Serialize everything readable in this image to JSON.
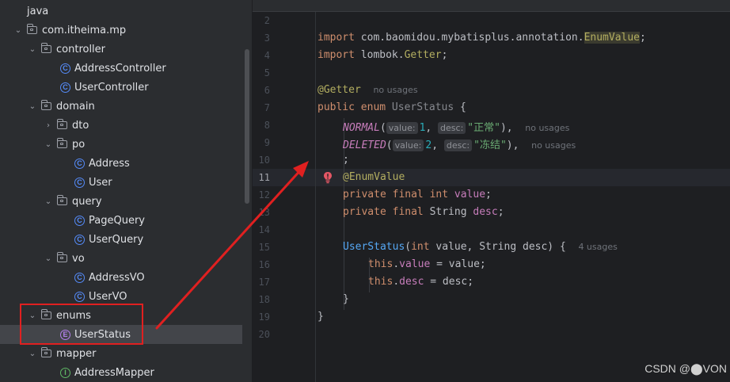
{
  "tree": {
    "items": [
      {
        "label": "java"
      },
      {
        "label": "com.itheima.mp"
      },
      {
        "label": "controller"
      },
      {
        "label": "AddressController"
      },
      {
        "label": "UserController"
      },
      {
        "label": "domain"
      },
      {
        "label": "dto"
      },
      {
        "label": "po"
      },
      {
        "label": "Address"
      },
      {
        "label": "User"
      },
      {
        "label": "query"
      },
      {
        "label": "PageQuery"
      },
      {
        "label": "UserQuery"
      },
      {
        "label": "vo"
      },
      {
        "label": "AddressVO"
      },
      {
        "label": "UserVO"
      },
      {
        "label": "enums"
      },
      {
        "label": "UserStatus"
      },
      {
        "label": "mapper"
      },
      {
        "label": "AddressMapper"
      }
    ],
    "selected": "UserStatus"
  },
  "editor": {
    "line_numbers": [
      "2",
      "3",
      "4",
      "5",
      "6",
      "7",
      "8",
      "9",
      "10",
      "11",
      "12",
      "13",
      "14",
      "15",
      "16",
      "17",
      "18",
      "19",
      "20"
    ],
    "current_line": "11",
    "code": {
      "l3_import": "import",
      "l3_pkg": " com.baomidou.mybatisplus.annotation.",
      "l3_cls": "EnumValue",
      "l3_end": ";",
      "l4_import": "import",
      "l4_pkg": " lombok.",
      "l4_cls": "Getter",
      "l4_end": ";",
      "l6_ann": "@Getter",
      "l6_usages": "no usages",
      "l7_kw": "public enum",
      "l7_name": " UserStatus ",
      "l7_brace": "{",
      "l8_const": "NORMAL",
      "l8_open": "(",
      "l8_hint1": "value:",
      "l8_val": "1",
      "l8_comma": ",",
      "l8_hint2": "desc:",
      "l8_str": "\"正常\"",
      "l8_close": "),",
      "l8_usages": "no usages",
      "l9_const": "DELETED",
      "l9_open": "(",
      "l9_hint1": "value:",
      "l9_val": "2",
      "l9_comma": ",",
      "l9_hint2": "desc:",
      "l9_str": "\"冻结\"",
      "l9_close": "),",
      "l9_usages": "no usages",
      "l10": ";",
      "l11_ann": "@EnumValue",
      "l12_kw": "private final int",
      "l12_fld": " value",
      "l12_end": ";",
      "l13_kw": "private final",
      "l13_type": " String",
      "l13_fld": " desc",
      "l13_end": ";",
      "l15_fn": "UserStatus",
      "l15_open": "(",
      "l15_kw": "int",
      "l15_rest": " value, String desc) {",
      "l15_usages": "4 usages",
      "l16_this": "this",
      "l16_dot": ".",
      "l16_fld": "value",
      "l16_rest": " = value;",
      "l17_this": "this",
      "l17_dot": ".",
      "l17_fld": "desc",
      "l17_rest": " = desc;",
      "l18": "}",
      "l19": "}"
    }
  },
  "watermark": "CSDN @⬤VON",
  "colors": {
    "highlight_box": "#e02020",
    "arrow": "#e02020"
  }
}
